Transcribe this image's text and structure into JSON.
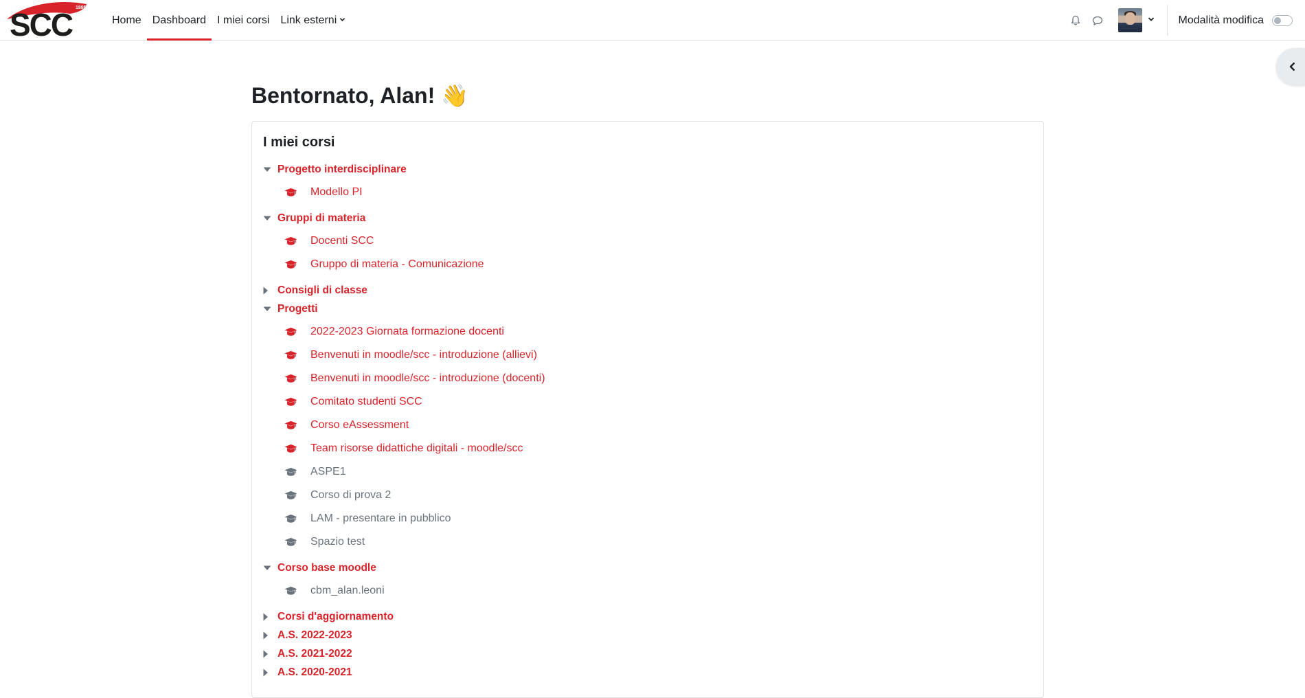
{
  "brand": {
    "logo_text": "SCC",
    "logo_year": "1895",
    "accent_color": "#d8232a",
    "hidden_color": "#6a737b"
  },
  "nav": {
    "items": [
      {
        "label": "Home"
      },
      {
        "label": "Dashboard"
      },
      {
        "label": "I miei corsi"
      },
      {
        "label": "Link esterni"
      }
    ],
    "active": "Dashboard",
    "notifications_icon": "bell-icon",
    "messages_icon": "chat-bubble-icon",
    "edit_mode_label": "Modalità modifica",
    "edit_mode_on": false
  },
  "main": {
    "greeting": "Bentornato, Alan! 👋",
    "block_title": "I miei corsi",
    "categories": [
      {
        "label": "Progetto interdisciplinare",
        "expanded": true,
        "courses": [
          {
            "label": "Modello PI",
            "visible": true
          }
        ]
      },
      {
        "label": "Gruppi di materia",
        "expanded": true,
        "courses": [
          {
            "label": "Docenti SCC",
            "visible": true
          },
          {
            "label": "Gruppo di materia - Comunicazione",
            "visible": true
          }
        ]
      },
      {
        "label": "Consigli di classe",
        "expanded": false,
        "courses": []
      },
      {
        "label": "Progetti",
        "expanded": true,
        "courses": [
          {
            "label": "2022-2023 Giornata formazione docenti",
            "visible": true
          },
          {
            "label": "Benvenuti in moodle/scc - introduzione (allievi)",
            "visible": true
          },
          {
            "label": "Benvenuti in moodle/scc - introduzione (docenti)",
            "visible": true
          },
          {
            "label": "Comitato studenti SCC",
            "visible": true
          },
          {
            "label": "Corso eAssessment",
            "visible": true
          },
          {
            "label": "Team risorse didattiche digitali - moodle/scc",
            "visible": true
          },
          {
            "label": "ASPE1",
            "visible": false
          },
          {
            "label": "Corso di prova 2",
            "visible": false
          },
          {
            "label": "LAM - presentare in pubblico",
            "visible": false
          },
          {
            "label": "Spazio test",
            "visible": false
          }
        ]
      },
      {
        "label": "Corso base moodle",
        "expanded": true,
        "courses": [
          {
            "label": "cbm_alan.leoni",
            "visible": false
          }
        ]
      },
      {
        "label": "Corsi d'aggiornamento",
        "expanded": false,
        "courses": []
      },
      {
        "label": "A.S. 2022-2023",
        "expanded": false,
        "courses": []
      },
      {
        "label": "A.S. 2021-2022",
        "expanded": false,
        "courses": []
      },
      {
        "label": "A.S. 2020-2021",
        "expanded": false,
        "courses": []
      }
    ]
  }
}
